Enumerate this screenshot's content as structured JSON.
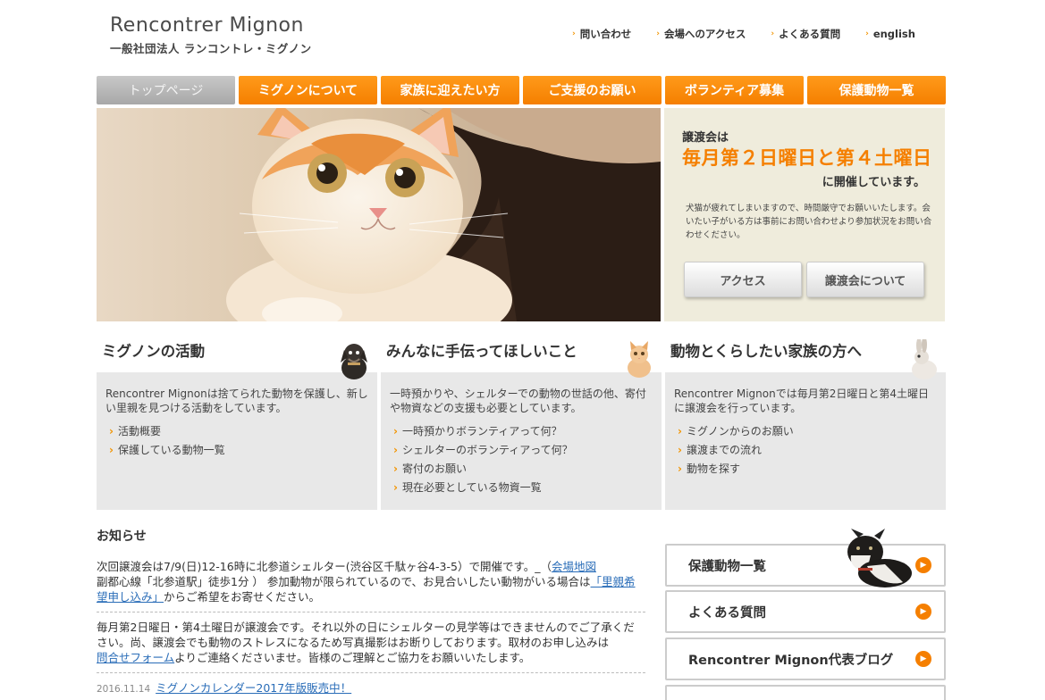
{
  "header": {
    "logo_en": "Rencontrer Mignon",
    "logo_ja": "一般社団法人 ランコントレ・ミグノン",
    "links": [
      "問い合わせ",
      "会場へのアクセス",
      "よくある質問",
      "english"
    ]
  },
  "nav": {
    "tabs": [
      "トップページ",
      "ミグノンについて",
      "家族に迎えたい方",
      "ご支援のお願い",
      "ボランティア募集",
      "保護動物一覧"
    ]
  },
  "hero_side": {
    "line1": "譲渡会は",
    "big": "毎月第２日曜日と第４土曜日",
    "line3": "に開催しています。",
    "note": "犬猫が疲れてしまいますので、時間厳守でお願いいたします。会いたい子がいる方は事前にお問い合わせより参加状況をお問い合わせください。",
    "btn_access": "アクセス",
    "btn_about": "譲渡会について"
  },
  "columns": [
    {
      "title": "ミグノンの活動",
      "desc": "Rencontrer Mignonは捨てられた動物を保護し、新しい里親を見つける活動をしています。",
      "items": [
        "活動概要",
        "保護している動物一覧"
      ]
    },
    {
      "title": "みんなに手伝ってほしいこと",
      "desc": "一時預かりや、シェルターでの動物の世話の他、寄付や物資などの支援も必要としています。",
      "items": [
        "一時預かりボランティアって何？",
        "シェルターのボランティアって何？",
        "寄付のお願い",
        "現在必要としている物資一覧"
      ]
    },
    {
      "title": "動物とくらしたい家族の方へ",
      "desc": "Rencontrer Mignonでは毎月第2日曜日と第4土曜日に譲渡会を行っています。",
      "items": [
        "ミグノンからのお願い",
        "譲渡までの流れ",
        "動物を探す"
      ]
    }
  ],
  "news": {
    "title": "お知らせ",
    "item1_text1": "次回譲渡会は7/9(日)12-16時に北参道シェルター(渋谷区千駄ヶ谷4-3-5）で開催です。_（",
    "item1_link1": "会場地図",
    "item1_text2": "副都心線「北参道駅」徒歩1分 ） 参加動物が限られているので、お見合いしたい動物がいる場合は",
    "item1_link2": "「里親希望申し込み」",
    "item1_text3": "からご希望をお寄せください。",
    "item2_text1": "毎月第2日曜日・第4土曜日が譲渡会です。それ以外の日にシェルターの見学等はできませんのでご了承ください。尚、譲渡会でも動物のストレスになるため写真撮影はお断りしております。取材のお申し込みは",
    "item2_link": "問合せフォーム",
    "item2_text2": "よりご連絡くださいませ。皆様のご理解とご協力をお願いいたします。",
    "item3_date": "2016.11.14",
    "item3_link": "ミグノンカレンダー2017年版販売中！"
  },
  "side_buttons": [
    "保護動物一覧",
    "よくある質問",
    "Rencontrer Mignon代表ブログ"
  ]
}
